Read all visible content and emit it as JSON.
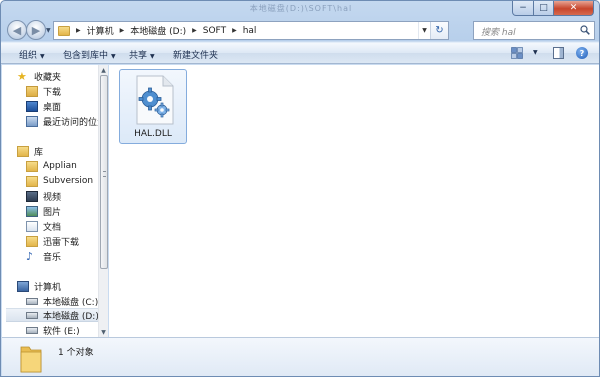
{
  "window": {
    "title": "本地磁盘(D:)\\SOFT\\hal",
    "buttons": {
      "minimize": "−",
      "maximize": "□",
      "close": "✕"
    }
  },
  "address_bar": {
    "crumbs": [
      "计算机",
      "本地磁盘 (D:)",
      "SOFT",
      "hal"
    ],
    "refresh_icon": "refresh-icon"
  },
  "search": {
    "placeholder": "搜索 hal"
  },
  "toolbar": {
    "organize": "组织",
    "include_in_library": "包含到库中",
    "share": "共享",
    "new_folder": "新建文件夹"
  },
  "nav": {
    "favorites": "收藏夹",
    "downloads": "下载",
    "desktop": "桌面",
    "recent": "最近访问的位置",
    "libraries": "库",
    "applian": "Applian",
    "subversion": "Subversion",
    "videos": "视频",
    "pictures": "图片",
    "documents": "文档",
    "thunder": "迅雷下载",
    "music": "音乐",
    "computer": "计算机",
    "drive_c": "本地磁盘 (C:)",
    "drive_d": "本地磁盘 (D:)",
    "drive_e": "软件 (E:)"
  },
  "files": [
    {
      "name": "HAL.DLL",
      "icon": "dll-gear-icon",
      "selected": true
    }
  ],
  "status": {
    "item_count": "1 个对象"
  },
  "colors": {
    "accent": "#2b5fa8",
    "selection_border": "#84acdd",
    "close_button": "#c7452c"
  }
}
